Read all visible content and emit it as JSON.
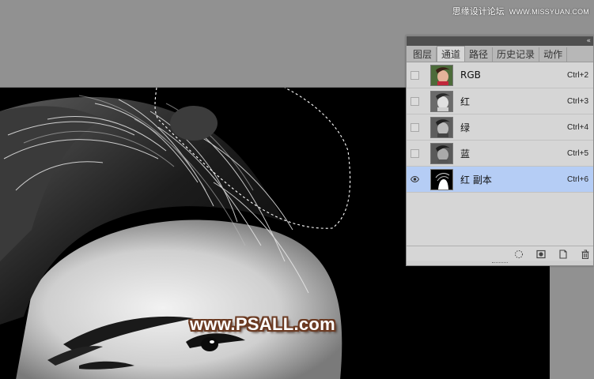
{
  "watermark_top": {
    "cn": "思缘设计论坛",
    "site": "WWW.MISSYUAN.COM"
  },
  "watermark_bottom": "www.PSALL.com",
  "panel": {
    "tabs": [
      {
        "label": "图层",
        "active": false
      },
      {
        "label": "通道",
        "active": true
      },
      {
        "label": "路径",
        "active": false
      },
      {
        "label": "历史记录",
        "active": false
      },
      {
        "label": "动作",
        "active": false
      }
    ],
    "channels": [
      {
        "name": "RGB",
        "shortcut": "Ctrl+2",
        "visible": false,
        "selected": false,
        "thumb": "color"
      },
      {
        "name": "红",
        "shortcut": "Ctrl+3",
        "visible": false,
        "selected": false,
        "thumb": "gray"
      },
      {
        "name": "绿",
        "shortcut": "Ctrl+4",
        "visible": false,
        "selected": false,
        "thumb": "gray"
      },
      {
        "name": "蓝",
        "shortcut": "Ctrl+5",
        "visible": false,
        "selected": false,
        "thumb": "gray"
      },
      {
        "name": "红 副本",
        "shortcut": "Ctrl+6",
        "visible": true,
        "selected": true,
        "thumb": "mask"
      }
    ],
    "bottom_icons": [
      "dotted-selection-icon",
      "save-mask-icon",
      "new-channel-icon",
      "trash-icon"
    ]
  },
  "colors": {
    "selected_row": "#b5cdf5",
    "canvas_bg": "#000000",
    "workspace": "#919191"
  }
}
